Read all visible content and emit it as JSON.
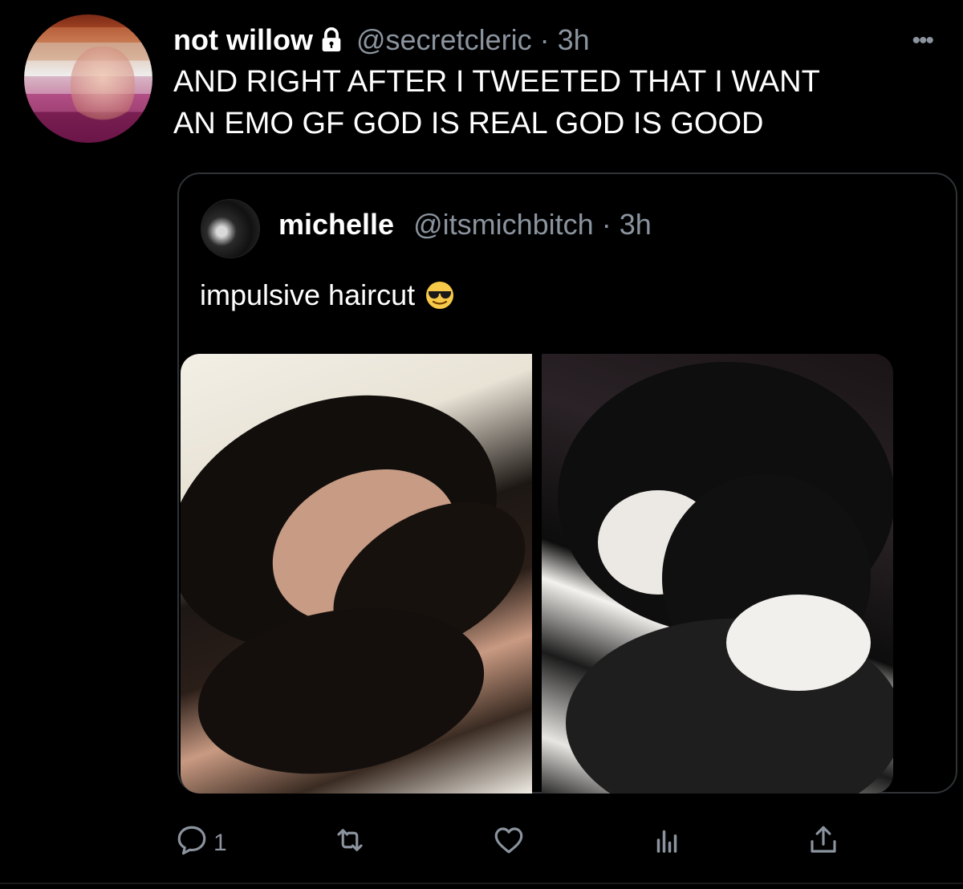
{
  "tweet": {
    "author_name": "not willow",
    "author_handle": "@secretcleric",
    "separator": "·",
    "time": "3h",
    "text": "AND RIGHT AFTER I TWEETED THAT I WANT\nAN EMO GF GOD IS REAL GOD IS GOOD",
    "more_label": "•••"
  },
  "quoted_tweet": {
    "author_name": "michelle",
    "author_handle": "@itsmichbitch",
    "separator": "·",
    "time": "3h",
    "text": "impulsive haircut",
    "emoji": "smiling-face-with-sunglasses"
  },
  "actions": {
    "reply_count": "1",
    "retweet_count": "",
    "like_count": "",
    "icons": [
      "reply-icon",
      "retweet-icon",
      "like-icon",
      "analytics-icon",
      "share-icon"
    ]
  },
  "colors": {
    "background": "#000000",
    "text": "#ffffff",
    "secondary_text": "#8b949e",
    "border": "#2f3336"
  }
}
